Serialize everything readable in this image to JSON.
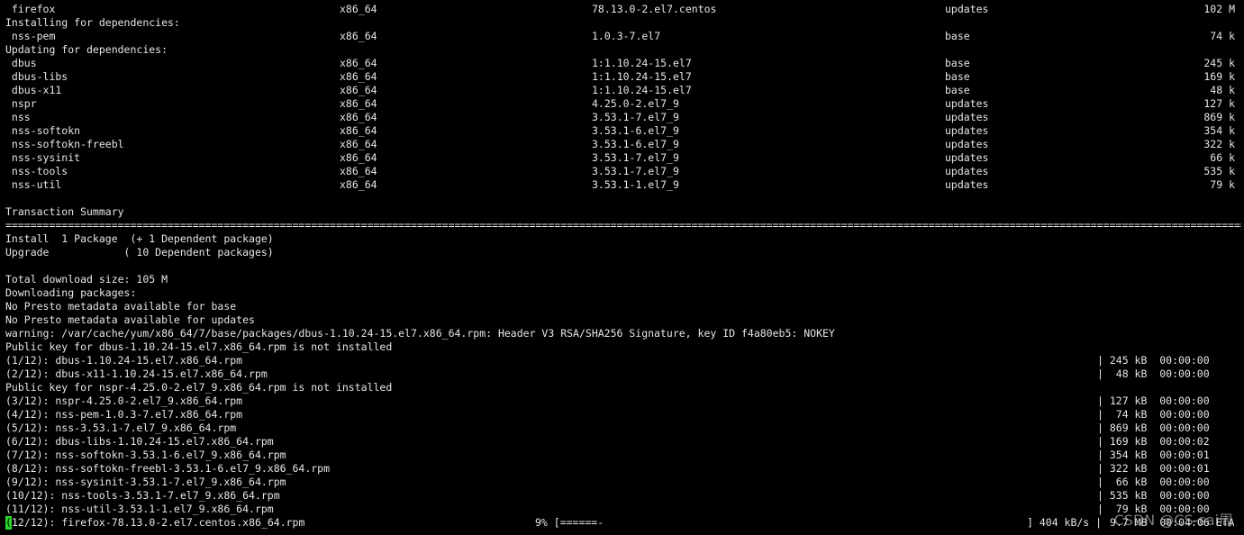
{
  "package_rows": [
    {
      "name": " firefox",
      "arch": "x86_64",
      "version": "78.13.0-2.el7.centos",
      "repo": "updates",
      "size": "102 M"
    },
    {
      "header": "Installing for dependencies:"
    },
    {
      "name": " nss-pem",
      "arch": "x86_64",
      "version": "1.0.3-7.el7",
      "repo": "base",
      "size": "74 k"
    },
    {
      "header": "Updating for dependencies:"
    },
    {
      "name": " dbus",
      "arch": "x86_64",
      "version": "1:1.10.24-15.el7",
      "repo": "base",
      "size": "245 k"
    },
    {
      "name": " dbus-libs",
      "arch": "x86_64",
      "version": "1:1.10.24-15.el7",
      "repo": "base",
      "size": "169 k"
    },
    {
      "name": " dbus-x11",
      "arch": "x86_64",
      "version": "1:1.10.24-15.el7",
      "repo": "base",
      "size": "48 k"
    },
    {
      "name": " nspr",
      "arch": "x86_64",
      "version": "4.25.0-2.el7_9",
      "repo": "updates",
      "size": "127 k"
    },
    {
      "name": " nss",
      "arch": "x86_64",
      "version": "3.53.1-7.el7_9",
      "repo": "updates",
      "size": "869 k"
    },
    {
      "name": " nss-softokn",
      "arch": "x86_64",
      "version": "3.53.1-6.el7_9",
      "repo": "updates",
      "size": "354 k"
    },
    {
      "name": " nss-softokn-freebl",
      "arch": "x86_64",
      "version": "3.53.1-6.el7_9",
      "repo": "updates",
      "size": "322 k"
    },
    {
      "name": " nss-sysinit",
      "arch": "x86_64",
      "version": "3.53.1-7.el7_9",
      "repo": "updates",
      "size": "66 k"
    },
    {
      "name": " nss-tools",
      "arch": "x86_64",
      "version": "3.53.1-7.el7_9",
      "repo": "updates",
      "size": "535 k"
    },
    {
      "name": " nss-util",
      "arch": "x86_64",
      "version": "3.53.1-1.el7_9",
      "repo": "updates",
      "size": "79 k"
    }
  ],
  "summary": {
    "title": "Transaction Summary",
    "separator": "==============================================================================================================================================================================================================================",
    "install_line": "Install  1 Package  (+ 1 Dependent package)",
    "upgrade_line": "Upgrade            ( 10 Dependent packages)",
    "total_download": "Total download size: 105 M",
    "downloading": "Downloading packages:",
    "presto_base": "No Presto metadata available for base",
    "presto_updates": "No Presto metadata available for updates",
    "warning": "warning: /var/cache/yum/x86_64/7/base/packages/dbus-1.10.24-15.el7.x86_64.rpm: Header V3 RSA/SHA256 Signature, key ID f4a80eb5: NOKEY"
  },
  "download_lines": [
    {
      "text": "Public key for dbus-1.10.24-15.el7.x86_64.rpm is not installed",
      "stats": ""
    },
    {
      "text": "(1/12): dbus-1.10.24-15.el7.x86_64.rpm",
      "stats": "| 245 kB  00:00:00"
    },
    {
      "text": "(2/12): dbus-x11-1.10.24-15.el7.x86_64.rpm",
      "stats": "|  48 kB  00:00:00"
    },
    {
      "text": "Public key for nspr-4.25.0-2.el7_9.x86_64.rpm is not installed",
      "stats": ""
    },
    {
      "text": "(3/12): nspr-4.25.0-2.el7_9.x86_64.rpm",
      "stats": "| 127 kB  00:00:00"
    },
    {
      "text": "(4/12): nss-pem-1.0.3-7.el7.x86_64.rpm",
      "stats": "|  74 kB  00:00:00"
    },
    {
      "text": "(5/12): nss-3.53.1-7.el7_9.x86_64.rpm",
      "stats": "| 869 kB  00:00:00"
    },
    {
      "text": "(6/12): dbus-libs-1.10.24-15.el7.x86_64.rpm",
      "stats": "| 169 kB  00:00:02"
    },
    {
      "text": "(7/12): nss-softokn-3.53.1-6.el7_9.x86_64.rpm",
      "stats": "| 354 kB  00:00:01"
    },
    {
      "text": "(8/12): nss-softokn-freebl-3.53.1-6.el7_9.x86_64.rpm",
      "stats": "| 322 kB  00:00:01"
    },
    {
      "text": "(9/12): nss-sysinit-3.53.1-7.el7_9.x86_64.rpm",
      "stats": "|  66 kB  00:00:00"
    },
    {
      "text": "(10/12): nss-tools-3.53.1-7.el7_9.x86_64.rpm",
      "stats": "| 535 kB  00:00:00"
    },
    {
      "text": "(11/12): nss-util-3.53.1-1.el7_9.x86_64.rpm",
      "stats": "|  79 kB  00:00:00"
    }
  ],
  "progress": {
    "cursor_char": "(",
    "text": "12/12): firefox-78.13.0-2.el7.centos.x86_64.rpm",
    "percent_text": "9% [======-",
    "speed_text": "] 404 kB/s |",
    "size_eta_text": "9.7 MB  00:04:06 ETA",
    "percent_value": 9
  },
  "watermark": "CSDN @CS-sai周"
}
